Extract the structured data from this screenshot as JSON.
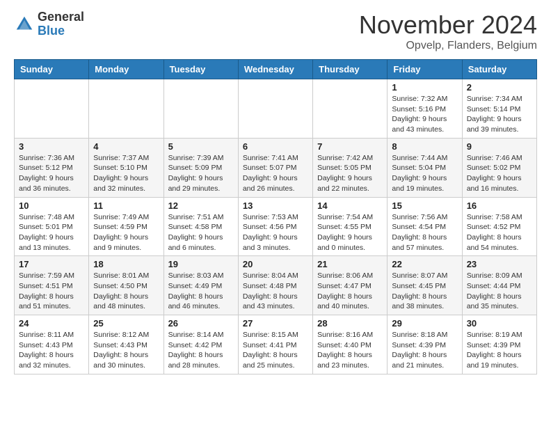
{
  "logo": {
    "general": "General",
    "blue": "Blue"
  },
  "header": {
    "month_title": "November 2024",
    "location": "Opvelp, Flanders, Belgium"
  },
  "days_of_week": [
    "Sunday",
    "Monday",
    "Tuesday",
    "Wednesday",
    "Thursday",
    "Friday",
    "Saturday"
  ],
  "weeks": [
    [
      {
        "day": "",
        "info": ""
      },
      {
        "day": "",
        "info": ""
      },
      {
        "day": "",
        "info": ""
      },
      {
        "day": "",
        "info": ""
      },
      {
        "day": "",
        "info": ""
      },
      {
        "day": "1",
        "info": "Sunrise: 7:32 AM\nSunset: 5:16 PM\nDaylight: 9 hours and 43 minutes."
      },
      {
        "day": "2",
        "info": "Sunrise: 7:34 AM\nSunset: 5:14 PM\nDaylight: 9 hours and 39 minutes."
      }
    ],
    [
      {
        "day": "3",
        "info": "Sunrise: 7:36 AM\nSunset: 5:12 PM\nDaylight: 9 hours and 36 minutes."
      },
      {
        "day": "4",
        "info": "Sunrise: 7:37 AM\nSunset: 5:10 PM\nDaylight: 9 hours and 32 minutes."
      },
      {
        "day": "5",
        "info": "Sunrise: 7:39 AM\nSunset: 5:09 PM\nDaylight: 9 hours and 29 minutes."
      },
      {
        "day": "6",
        "info": "Sunrise: 7:41 AM\nSunset: 5:07 PM\nDaylight: 9 hours and 26 minutes."
      },
      {
        "day": "7",
        "info": "Sunrise: 7:42 AM\nSunset: 5:05 PM\nDaylight: 9 hours and 22 minutes."
      },
      {
        "day": "8",
        "info": "Sunrise: 7:44 AM\nSunset: 5:04 PM\nDaylight: 9 hours and 19 minutes."
      },
      {
        "day": "9",
        "info": "Sunrise: 7:46 AM\nSunset: 5:02 PM\nDaylight: 9 hours and 16 minutes."
      }
    ],
    [
      {
        "day": "10",
        "info": "Sunrise: 7:48 AM\nSunset: 5:01 PM\nDaylight: 9 hours and 13 minutes."
      },
      {
        "day": "11",
        "info": "Sunrise: 7:49 AM\nSunset: 4:59 PM\nDaylight: 9 hours and 9 minutes."
      },
      {
        "day": "12",
        "info": "Sunrise: 7:51 AM\nSunset: 4:58 PM\nDaylight: 9 hours and 6 minutes."
      },
      {
        "day": "13",
        "info": "Sunrise: 7:53 AM\nSunset: 4:56 PM\nDaylight: 9 hours and 3 minutes."
      },
      {
        "day": "14",
        "info": "Sunrise: 7:54 AM\nSunset: 4:55 PM\nDaylight: 9 hours and 0 minutes."
      },
      {
        "day": "15",
        "info": "Sunrise: 7:56 AM\nSunset: 4:54 PM\nDaylight: 8 hours and 57 minutes."
      },
      {
        "day": "16",
        "info": "Sunrise: 7:58 AM\nSunset: 4:52 PM\nDaylight: 8 hours and 54 minutes."
      }
    ],
    [
      {
        "day": "17",
        "info": "Sunrise: 7:59 AM\nSunset: 4:51 PM\nDaylight: 8 hours and 51 minutes."
      },
      {
        "day": "18",
        "info": "Sunrise: 8:01 AM\nSunset: 4:50 PM\nDaylight: 8 hours and 48 minutes."
      },
      {
        "day": "19",
        "info": "Sunrise: 8:03 AM\nSunset: 4:49 PM\nDaylight: 8 hours and 46 minutes."
      },
      {
        "day": "20",
        "info": "Sunrise: 8:04 AM\nSunset: 4:48 PM\nDaylight: 8 hours and 43 minutes."
      },
      {
        "day": "21",
        "info": "Sunrise: 8:06 AM\nSunset: 4:47 PM\nDaylight: 8 hours and 40 minutes."
      },
      {
        "day": "22",
        "info": "Sunrise: 8:07 AM\nSunset: 4:45 PM\nDaylight: 8 hours and 38 minutes."
      },
      {
        "day": "23",
        "info": "Sunrise: 8:09 AM\nSunset: 4:44 PM\nDaylight: 8 hours and 35 minutes."
      }
    ],
    [
      {
        "day": "24",
        "info": "Sunrise: 8:11 AM\nSunset: 4:43 PM\nDaylight: 8 hours and 32 minutes."
      },
      {
        "day": "25",
        "info": "Sunrise: 8:12 AM\nSunset: 4:43 PM\nDaylight: 8 hours and 30 minutes."
      },
      {
        "day": "26",
        "info": "Sunrise: 8:14 AM\nSunset: 4:42 PM\nDaylight: 8 hours and 28 minutes."
      },
      {
        "day": "27",
        "info": "Sunrise: 8:15 AM\nSunset: 4:41 PM\nDaylight: 8 hours and 25 minutes."
      },
      {
        "day": "28",
        "info": "Sunrise: 8:16 AM\nSunset: 4:40 PM\nDaylight: 8 hours and 23 minutes."
      },
      {
        "day": "29",
        "info": "Sunrise: 8:18 AM\nSunset: 4:39 PM\nDaylight: 8 hours and 21 minutes."
      },
      {
        "day": "30",
        "info": "Sunrise: 8:19 AM\nSunset: 4:39 PM\nDaylight: 8 hours and 19 minutes."
      }
    ]
  ]
}
